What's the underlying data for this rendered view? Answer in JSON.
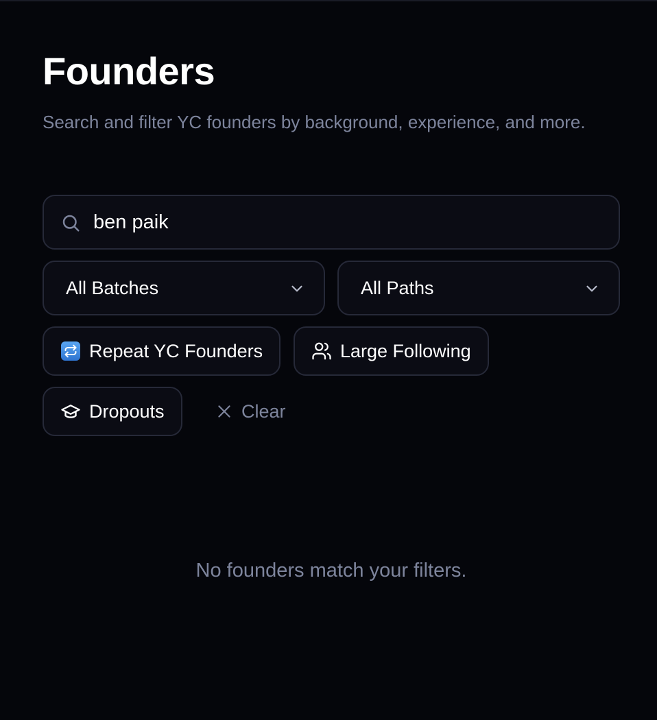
{
  "header": {
    "title": "Founders",
    "subtitle": "Search and filter YC founders by background, experience, and more."
  },
  "search": {
    "value": "ben paik",
    "icon": "search-icon"
  },
  "filters": {
    "batch_select": {
      "selected": "All Batches",
      "icon": "chevron-down-icon"
    },
    "path_select": {
      "selected": "All Paths",
      "icon": "chevron-down-icon"
    }
  },
  "chips": {
    "repeat": {
      "label": "Repeat YC Founders",
      "icon": "repeat-icon"
    },
    "following": {
      "label": "Large Following",
      "icon": "users-icon"
    },
    "dropouts": {
      "label": "Dropouts",
      "icon": "graduation-cap-icon"
    }
  },
  "clear": {
    "label": "Clear",
    "icon": "close-icon"
  },
  "empty_state": {
    "message": "No founders match your filters."
  },
  "colors": {
    "background": "#05060b",
    "surface": "#0b0c14",
    "border": "#262938",
    "muted_text": "#7d849c",
    "text": "#ffffff",
    "repeat_icon_blue": "#3b82e0"
  }
}
